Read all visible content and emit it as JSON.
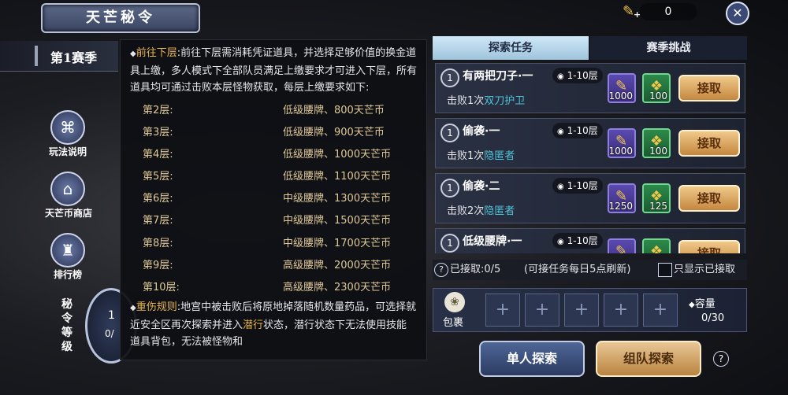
{
  "header": {
    "title": "天芒秘令",
    "currency_value": "0",
    "close_icon": "close-icon",
    "currency_icon": "feather-plus-icon"
  },
  "season": {
    "label": "第1赛季"
  },
  "sidebar": {
    "items": [
      {
        "label": "玩法说明",
        "icon": "scroll-icon"
      },
      {
        "label": "天芒币商店",
        "icon": "shop-icon"
      },
      {
        "label": "排行榜",
        "icon": "ranking-icon"
      }
    ],
    "rank_label": "秘令等级",
    "rank_level": "1",
    "rank_progress_partial": "0/"
  },
  "tooltip": {
    "section1_head": "前往下层",
    "section1_text_a": ":前往下层需消耗凭证道具，并选择足够价值的换金道具上缴，多人模式下全部队员满足上缴要求才可进入下层，所有道具均可通过击败本层怪物获取，每层上缴要求如下:",
    "floors": [
      {
        "floor": "第2层:",
        "item": "低级腰牌",
        "coin": "、800天芒币"
      },
      {
        "floor": "第3层:",
        "item": "低级腰牌",
        "coin": "、900天芒币"
      },
      {
        "floor": "第4层:",
        "item": "低级腰牌",
        "coin": "、1000天芒币"
      },
      {
        "floor": "第5层:",
        "item": "低级腰牌",
        "coin": "、1100天芒币"
      },
      {
        "floor": "第6层:",
        "item": "中级腰牌",
        "coin": "、1300天芒币"
      },
      {
        "floor": "第7层:",
        "item": "中级腰牌",
        "coin": "、1500天芒币"
      },
      {
        "floor": "第8层:",
        "item": "中级腰牌",
        "coin": "、1700天芒币"
      },
      {
        "floor": "第9层:",
        "item": "高级腰牌",
        "coin": "、2000天芒币"
      },
      {
        "floor": "第10层:",
        "item": "高级腰牌",
        "coin": "、2300天芒币"
      }
    ],
    "section2_head": "重伤规则",
    "section2_text_a": ":地宫中被击败后将原地掉落随机数量药品，可选择就近安全区再次探索并进入",
    "section2_hl": "潜行",
    "section2_text_b": "状态，潜行状态下无法使用技能道具背包，无法被怪物和"
  },
  "tabs": [
    {
      "label": "探索任务",
      "active": true
    },
    {
      "label": "赛季挑战",
      "active": false
    }
  ],
  "tasks": [
    {
      "badge": "1",
      "name": "有两把刀子·一",
      "level": "1-10层",
      "goal_prefix": "击败1次",
      "goal_target": "双刀护卫",
      "reward1": "1000",
      "reward2": "100",
      "accept": "接取"
    },
    {
      "badge": "1",
      "name": "偷袭·一",
      "level": "1-10层",
      "goal_prefix": "击败1次",
      "goal_target": "隐匿者",
      "reward1": "1000",
      "reward2": "100",
      "accept": "接取"
    },
    {
      "badge": "1",
      "name": "偷袭·二",
      "level": "1-10层",
      "goal_prefix": "击败2次",
      "goal_target": "隐匿者",
      "reward1": "1250",
      "reward2": "125",
      "accept": "接取"
    },
    {
      "badge": "1",
      "name": "低级腰牌·一",
      "level": "1-10层",
      "goal_prefix": "",
      "goal_target": "",
      "reward1": "",
      "reward2": "",
      "accept": "接取"
    }
  ],
  "status": {
    "help_icon": "question-icon",
    "accepted_label": "已接取:",
    "accepted_value": "0/5",
    "refresh_note": "(可接任务每日5点刷新)",
    "only_accepted_label": "只显示已接取"
  },
  "bag": {
    "label": "包裹",
    "capacity_label": "容量",
    "capacity_value": "0/30",
    "slot_symbol": "+"
  },
  "actions": {
    "solo_label": "单人探索",
    "team_label": "组队探索",
    "help_icon": "question-icon"
  },
  "colors": {
    "highlight": "#e8b54d",
    "target": "#4ec3d8",
    "accent_gold": "#c5873f"
  }
}
